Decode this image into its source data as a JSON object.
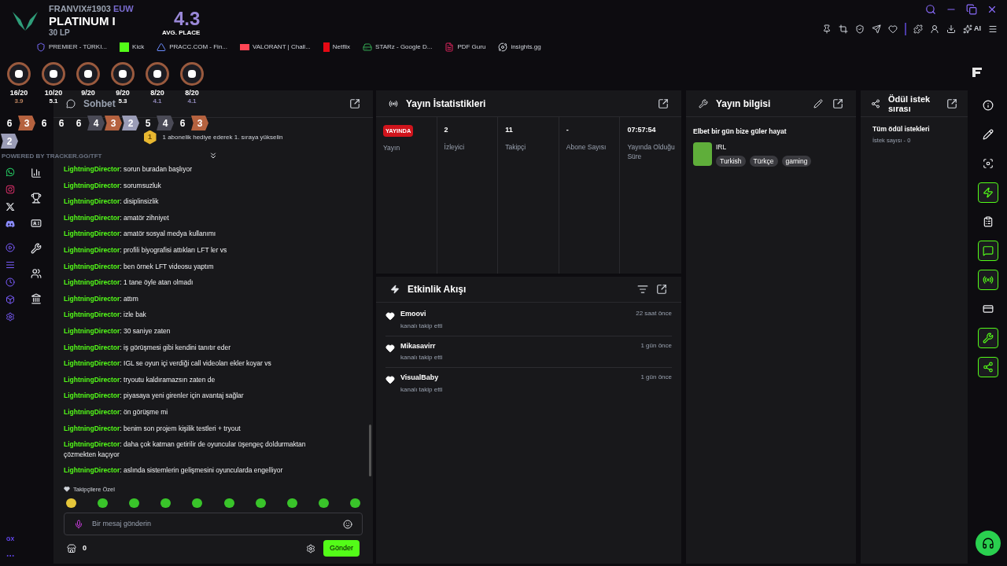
{
  "overlay": {
    "player": "FRANVIX#1903",
    "region": "EUW",
    "rank": "PLATINUM I",
    "lp": "30 LP",
    "avg_place": "4.3",
    "avg_label": "AVG. PLACE",
    "traits": [
      {
        "record": "16/20",
        "avg": "3.9",
        "color": "#b9825f"
      },
      {
        "record": "10/20",
        "avg": "5.1",
        "color": "#ffffff"
      },
      {
        "record": "9/20"
      },
      {
        "record": "9/20",
        "avg": "5.3",
        "color": "#ffffff"
      },
      {
        "record": "8/20",
        "avg": "4.1",
        "color": "#8f88b8"
      },
      {
        "record": "8/20",
        "avg": "4.1",
        "color": "#8f88b8"
      }
    ],
    "placements": [
      {
        "value": "6"
      },
      {
        "value": "3",
        "color": "#b5623f"
      },
      {
        "value": "6"
      },
      {
        "value": "6"
      },
      {
        "value": "6"
      },
      {
        "value": "4",
        "color": "#4a4a56"
      },
      {
        "value": "3",
        "color": "#b5623f"
      },
      {
        "value": "2",
        "color": "#9a9cb6"
      },
      {
        "value": "5"
      },
      {
        "value": "4",
        "color": "#4a4a56"
      },
      {
        "value": "6"
      },
      {
        "value": "3",
        "color": "#b5623f"
      },
      {
        "value": "2",
        "color": "#9a9cb6"
      }
    ],
    "credit": "POWERED BY TRACKER.GG/TFT"
  },
  "bookmarks": [
    {
      "label": "PREMIER - TÜRKI...",
      "kind": "shield"
    },
    {
      "label": "Kick",
      "kind": "kick"
    },
    {
      "label": "PRACC.COM - Fin...",
      "kind": "triangle"
    },
    {
      "label": "VALORANT | Chall...",
      "kind": "valorant"
    },
    {
      "label": "Netflix",
      "kind": "netflix"
    },
    {
      "label": "STARz - Google D...",
      "kind": "drive"
    },
    {
      "label": "PDF Guru",
      "kind": "pdf"
    },
    {
      "label": "insights.gg",
      "kind": "insights"
    }
  ],
  "toolbar": {
    "ai_label": "AI"
  },
  "browser_sidebar": {
    "gx_label": "GX"
  },
  "chat": {
    "title": "Sohbet",
    "pinned": {
      "rank": "1",
      "text": "1 abonelik hediye ederek 1. sıraya yükselin"
    },
    "messages": [
      {
        "user": "LightningDirector",
        "text": ": sorun buradan başlıyor"
      },
      {
        "user": "LightningDirector",
        "text": ": sorumsuzluk"
      },
      {
        "user": "LightningDirector",
        "text": ": disiplinsizlik"
      },
      {
        "user": "LightningDirector",
        "text": ": amatör zihniyet"
      },
      {
        "user": "LightningDirector",
        "text": ": amatör sosyal medya kullanımı"
      },
      {
        "user": "LightningDirector",
        "text": ": profili biyografisi attıkları LFT ler vs"
      },
      {
        "user": "LightningDirector",
        "text": ": ben örnek LFT videosu yaptım"
      },
      {
        "user": "LightningDirector",
        "text": ": 1 tane öyle atan olmadı"
      },
      {
        "user": "LightningDirector",
        "text": ": attım"
      },
      {
        "user": "LightningDirector",
        "text": ": izle bak"
      },
      {
        "user": "LightningDirector",
        "text": ": 30 saniye zaten"
      },
      {
        "user": "LightningDirector",
        "text": ": iş görüşmesi gibi kendini tanıtır eder"
      },
      {
        "user": "LightningDirector",
        "text": ": IGL se oyun içi verdiği call videoları ekler koyar vs"
      },
      {
        "user": "LightningDirector",
        "text": ": tryoutu kaldıramazsın zaten de"
      },
      {
        "user": "LightningDirector",
        "text": ": piyasaya yeni girenler için avantaj sağlar"
      },
      {
        "user": "LightningDirector",
        "text": ": ön görüşme mi"
      },
      {
        "user": "LightningDirector",
        "text": ": benim son projem kişilik testleri + tryout"
      },
      {
        "user": "LightningDirector",
        "text": ": daha çok katman getirilir de oyuncular üşengeç doldurmaktan çözmekten kaçıyor"
      },
      {
        "user": "LightningDirector",
        "text": ": aslında sistemlerin gelişmesini oyuncularda engelliyor"
      }
    ],
    "emote_label": "Takipçilere Özel",
    "input": {
      "placeholder": "Bir mesaj gönderin"
    },
    "points": "0",
    "send": "Gönder"
  },
  "stats": {
    "title": "Yayın İstatistikleri",
    "live": true,
    "badge": "YAYINDA",
    "columns": [
      {
        "label": "Yayın"
      },
      {
        "value": "2",
        "label": "İzleyici"
      },
      {
        "value": "11",
        "label": "Takipçi"
      },
      {
        "value": "-",
        "label": "Abone Sayısı"
      },
      {
        "value": "07:57:54",
        "label": "Yayında Olduğu Süre"
      }
    ]
  },
  "activity": {
    "title": "Etkinlik Akışı",
    "events": [
      {
        "user": "Emoovi",
        "action": "kanalı takip etti",
        "time": "22 saat önce"
      },
      {
        "user": "Mikasavirr",
        "action": "kanalı takip etti",
        "time": "1 gün önce"
      },
      {
        "user": "VisualBaby",
        "action": "kanalı takip etti",
        "time": "1 gün önce"
      }
    ]
  },
  "info": {
    "title": "Yayın bilgisi",
    "stream_title": "Elbet bir gün bize güler hayat",
    "category": "IRL",
    "tags": [
      "Turkish",
      "Türkçe",
      "gaming"
    ]
  },
  "rewards": {
    "title": "Ödül istek sırası",
    "list_title": "Tüm ödül istekleri",
    "count": "İstek sayısı - 0"
  },
  "tools": [
    {
      "kind": "info",
      "highlighted": false
    },
    {
      "kind": "pencil",
      "highlighted": false
    },
    {
      "kind": "focus",
      "highlighted": false
    },
    {
      "kind": "zap",
      "highlighted": true
    },
    {
      "kind": "clipboard",
      "highlighted": false
    },
    {
      "kind": "chat",
      "highlighted": true
    },
    {
      "kind": "radio",
      "highlighted": true
    },
    {
      "kind": "card",
      "highlighted": false
    },
    {
      "kind": "wrench",
      "highlighted": true
    },
    {
      "kind": "nodes",
      "highlighted": true
    }
  ]
}
